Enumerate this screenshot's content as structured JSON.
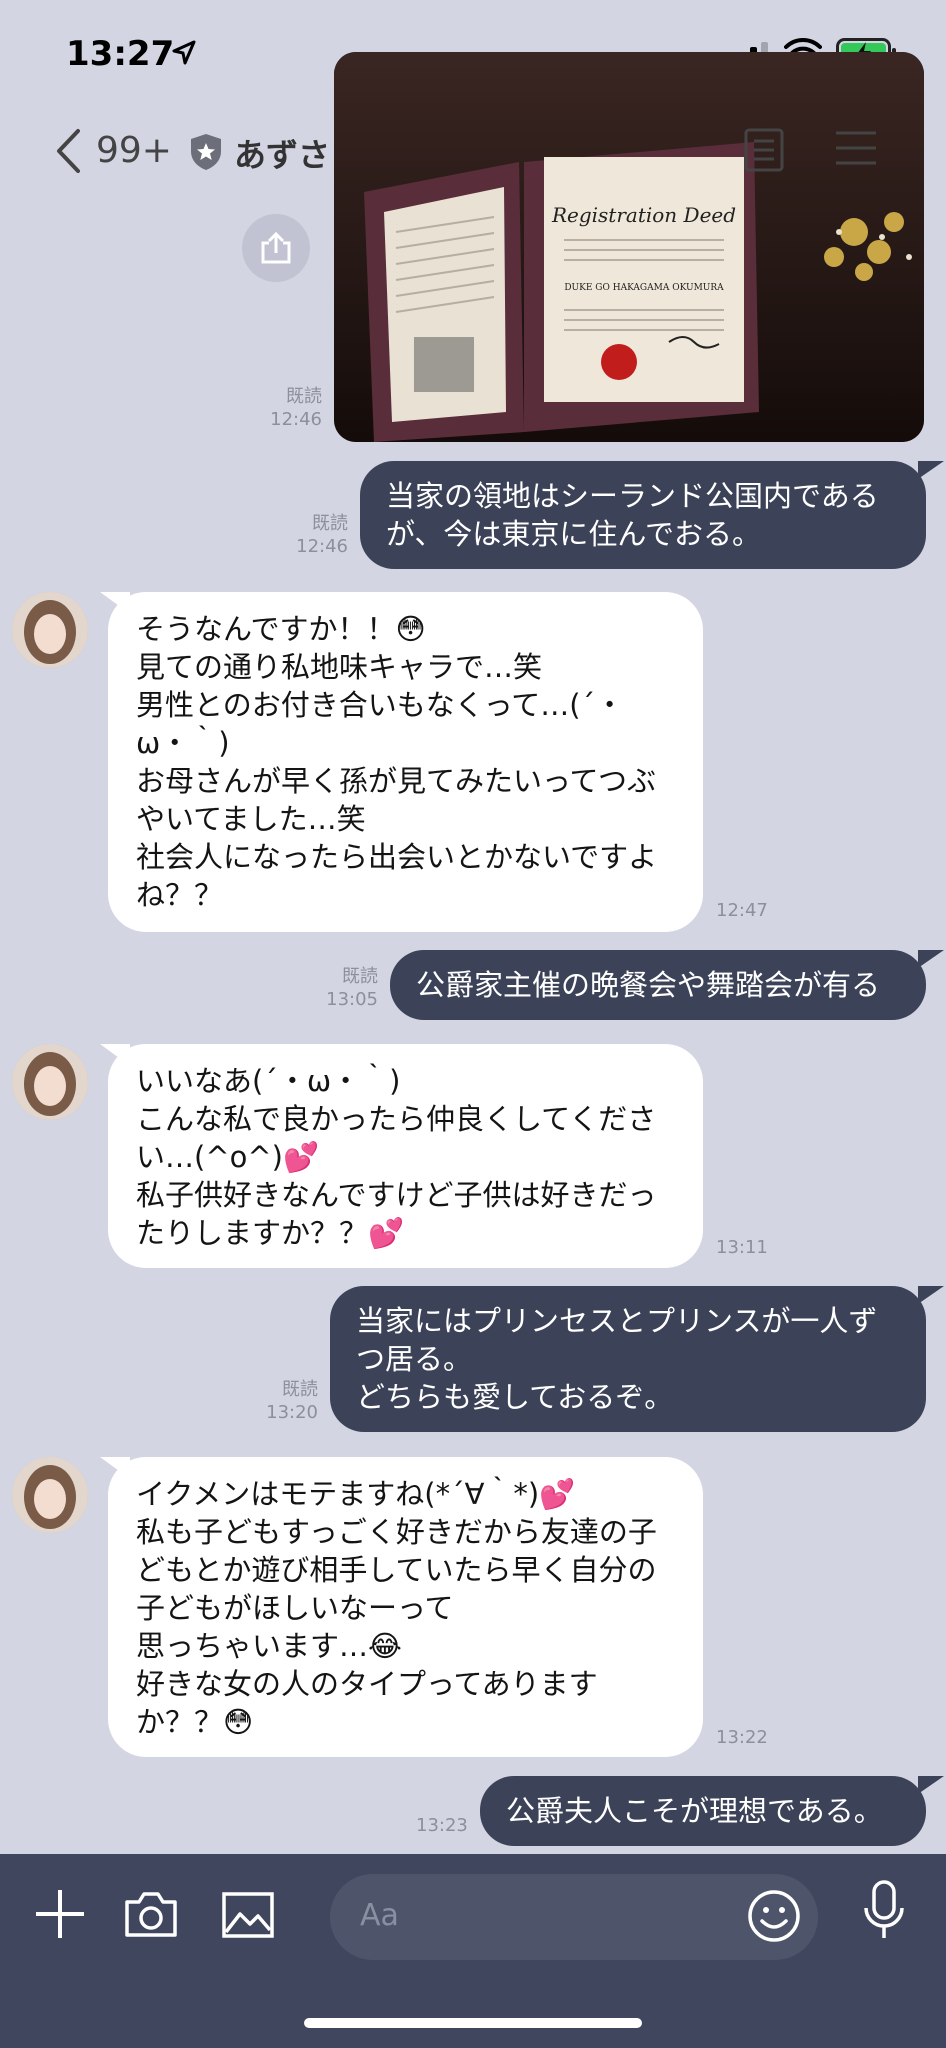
{
  "status_bar": {
    "time": "13:27",
    "icons": [
      "location-arrow-icon",
      "cellular-signal-icon",
      "wifi-icon",
      "battery-charging-icon"
    ]
  },
  "header": {
    "back_icon": "chevron-left-icon",
    "unread_count": "99+",
    "shield_icon": "shield-star-icon",
    "name": "あずさ",
    "right_icons": [
      "note-icon",
      "hamburger-menu-icon"
    ]
  },
  "messages": [
    {
      "id": "img1",
      "direction": "out",
      "type": "image",
      "read": "既読",
      "time": "12:46",
      "image_text": {
        "title": "Registration Deed",
        "name": "DUKE GO HAKAGAMA OKUMURA"
      },
      "share_icon": "share-icon"
    },
    {
      "id": "m1",
      "direction": "out",
      "read": "既読",
      "time": "12:46",
      "lines": [
        "当家の領地はシーランド公国内である",
        "が、今は東京に住んでおる。"
      ]
    },
    {
      "id": "m2",
      "direction": "in",
      "time": "12:47",
      "lines": [
        "そうなんですか！！😳",
        "見ての通り私地味キャラで…笑",
        "男性とのお付き合いもなくって…(´・",
        "ω・｀)",
        "お母さんが早く孫が見てみたいってつぶ",
        "やいてました…笑",
        "社会人になったら出会いとかないですよ",
        "ね？？"
      ]
    },
    {
      "id": "m3",
      "direction": "out",
      "read": "既読",
      "time": "13:05",
      "lines": [
        "公爵家主催の晩餐会や舞踏会が有る"
      ]
    },
    {
      "id": "m4",
      "direction": "in",
      "time": "13:11",
      "lines": [
        "いいなあ(´・ω・｀)",
        "こんな私で良かったら仲良くしてくださ",
        "い…(^o^)💕",
        "私子供好きなんですけど子供は好きだっ",
        "たりしますか？？💕"
      ]
    },
    {
      "id": "m5",
      "direction": "out",
      "read": "既読",
      "time": "13:20",
      "lines": [
        "当家にはプリンセスとプリンスが一人ず",
        "つ居る。",
        "どちらも愛しておるぞ。"
      ]
    },
    {
      "id": "m6",
      "direction": "in",
      "time": "13:22",
      "lines": [
        "イクメンはモテますね(*´∀｀*)💕",
        "私も子どもすっごく好きだから友達の子",
        "どもとか遊び相手していたら早く自分の",
        "子どもがほしいなーって",
        "思っちゃいます…😂",
        "好きな女の人のタイプってあります",
        "か？？😳"
      ]
    },
    {
      "id": "m7",
      "direction": "out",
      "time": "13:23",
      "lines": [
        "公爵夫人こそが理想である。"
      ]
    }
  ],
  "input_bar": {
    "icons": [
      "plus-icon",
      "camera-icon",
      "image-icon",
      "emoji-icon",
      "microphone-icon"
    ],
    "placeholder": "Aa"
  },
  "colors": {
    "background": "#d3d5e3",
    "outgoing_bubble": "#3c4257",
    "incoming_bubble": "#ffffff",
    "input_bar": "#40465d"
  }
}
